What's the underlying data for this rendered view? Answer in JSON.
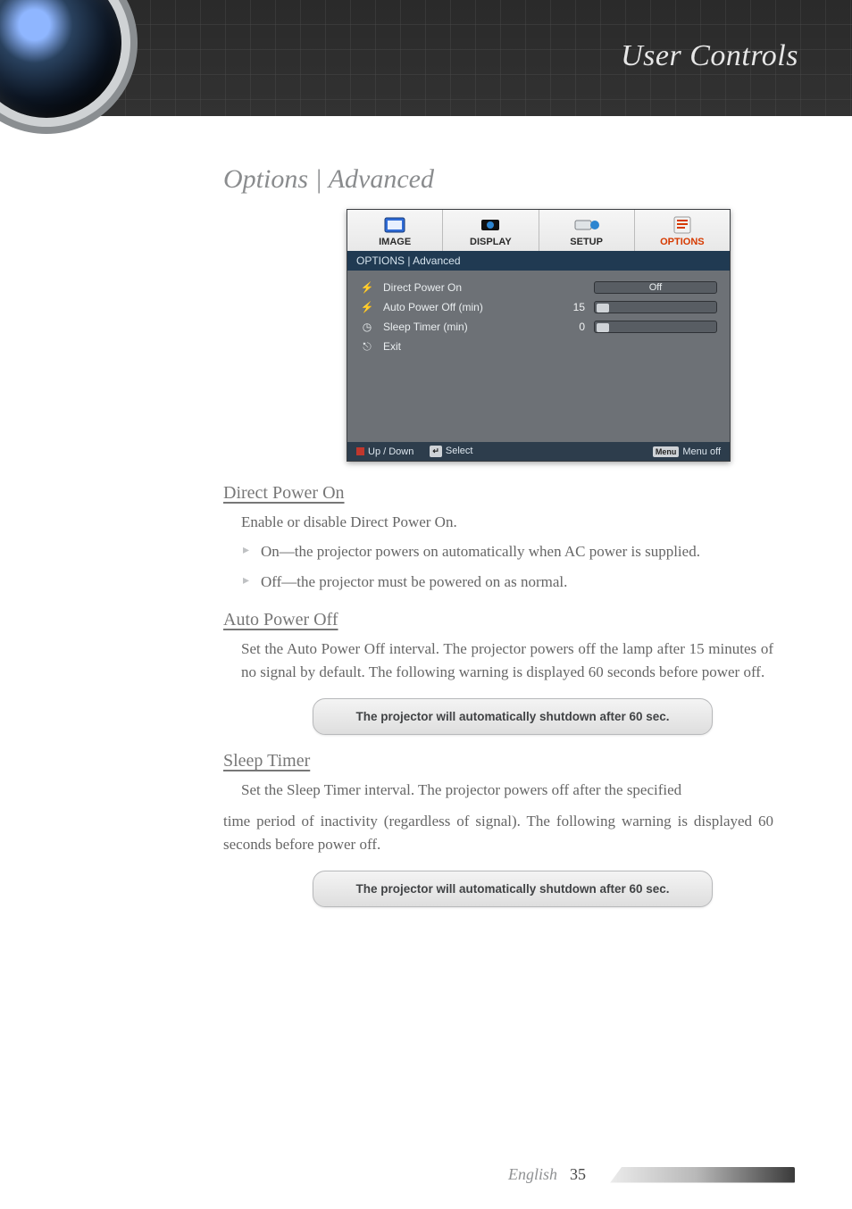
{
  "page": {
    "header_title": "User Controls",
    "section_heading": "Options | Advanced",
    "footer_label": "English",
    "page_number": "35"
  },
  "osd": {
    "tabs": [
      "IMAGE",
      "DISPLAY",
      "SETUP",
      "OPTIONS"
    ],
    "breadcrumb": "OPTIONS | Advanced",
    "rows": {
      "direct_power_on": {
        "label": "Direct Power On",
        "value": "Off"
      },
      "auto_power_off": {
        "label": "Auto Power Off (min)",
        "value": "15"
      },
      "sleep_timer": {
        "label": "Sleep Timer (min)",
        "value": "0"
      },
      "exit": {
        "label": "Exit"
      }
    },
    "footer": {
      "updown": "Up / Down",
      "select": "Select",
      "menu_key": "Menu",
      "menu_off": "Menu off"
    }
  },
  "sections": {
    "direct_power_on": {
      "heading": "Direct Power On",
      "intro": "Enable or disable Direct Power On.",
      "bullets": [
        "On—the projector powers on automatically when AC power is supplied.",
        "Off—the projector must be powered on as normal."
      ]
    },
    "auto_power_off": {
      "heading": "Auto Power Off",
      "body": "Set the Auto Power Off interval. The projector powers off the lamp after 15 minutes of no signal by default. The following warning is displayed 60 seconds before power off.",
      "toast": "The projector will automatically shutdown after  60 sec."
    },
    "sleep_timer": {
      "heading": "Sleep Timer",
      "body1": "Set the Sleep Timer interval. The projector powers off after the specified",
      "body2": "time period of inactivity (regardless of signal). The following warning is displayed 60 seconds before power off.",
      "toast": "The projector will automatically shutdown after  60 sec."
    }
  }
}
